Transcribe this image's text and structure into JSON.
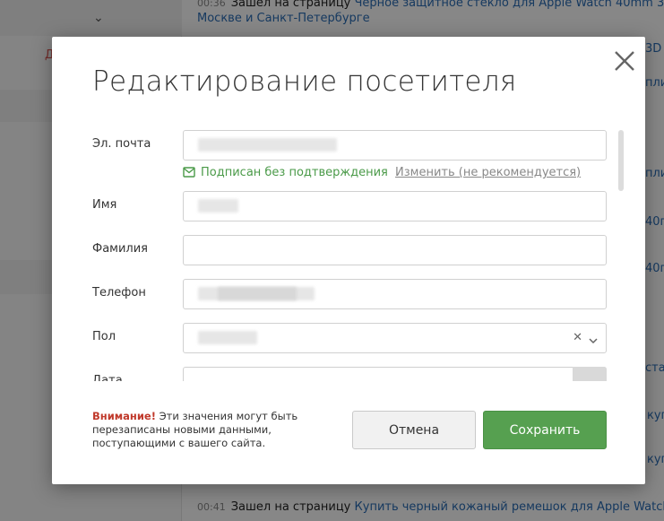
{
  "background": {
    "top_log": {
      "time": "00:36",
      "action": "Зашел на страницу",
      "link": "Черное защитное стекло для Apple Watch 40mm 3D",
      "link_line2": "Москве и Санкт-Петербурге"
    },
    "bottom_log": {
      "time": "00:41",
      "action": "Зашел на страницу",
      "link": "Купить черный кожаный ремешок для Apple Watch"
    },
    "left_fragment": "Д",
    "right_fragments": [
      "3D",
      "плит",
      "плит",
      "40п",
      "40п",
      "став",
      "куп",
      "куп",
      "куп"
    ]
  },
  "modal": {
    "title": "Редактирование посетителя",
    "fields": {
      "email_label": "Эл. почта",
      "subscribe_status": "Подписан без подтверждения",
      "change_link": "Изменить (не рекомендуется)",
      "first_name_label": "Имя",
      "last_name_label": "Фамилия",
      "phone_label": "Телефон",
      "gender_label": "Пол",
      "birth_label": "Дата"
    },
    "warning_strong": "Внимание!",
    "warning_text": "Эти значения могут быть перезаписаны новыми данными, поступающими с вашего сайта.",
    "cancel_label": "Отмена",
    "save_label": "Сохранить"
  },
  "colors": {
    "accent_green": "#56a050",
    "link_blue": "#2a6db5",
    "warning_red": "#c0392b"
  },
  "icons": [
    "close-icon",
    "envelope-icon",
    "clear-icon",
    "chevron-down-icon",
    "calendar-icon"
  ]
}
